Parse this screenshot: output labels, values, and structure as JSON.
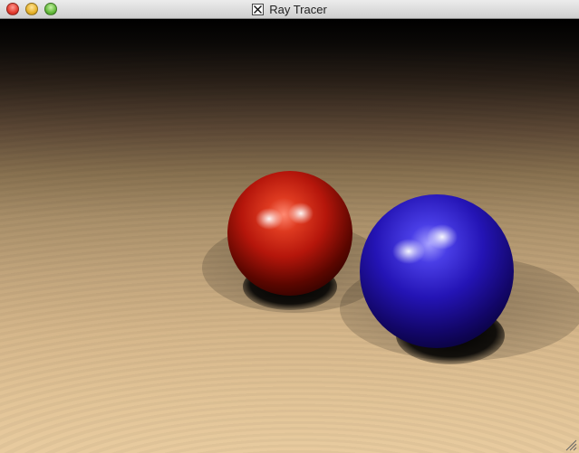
{
  "window": {
    "title": "Ray Tracer",
    "app_icon": "x11-icon"
  },
  "titlebar_buttons": {
    "close": "close-button",
    "minimize": "minimize-button",
    "zoom": "zoom-button"
  },
  "scene": {
    "spheres": [
      {
        "name": "red-sphere",
        "color": "#b5160b"
      },
      {
        "name": "blue-sphere",
        "color": "#1a0a8c"
      }
    ],
    "floor_color": "#d8b98c"
  }
}
